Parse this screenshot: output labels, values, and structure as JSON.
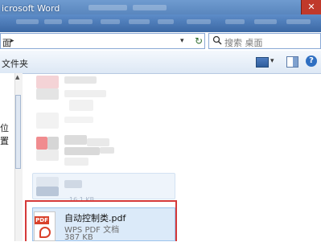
{
  "window": {
    "title": "icrosoft Word",
    "close_glyph": "✕"
  },
  "address": {
    "path_text": "面",
    "chevron": "▸",
    "dropdown": "▾",
    "refresh_glyph": "↻"
  },
  "search": {
    "placeholder": "搜索 桌面",
    "icon": "search-icon"
  },
  "commandbar": {
    "label": "文件夹",
    "view_dropdown": "▾",
    "help_glyph": "?"
  },
  "nav": {
    "label": "位置",
    "scroll_up": "▲"
  },
  "files": [
    {
      "name": "自动控制类.pdf",
      "type": "WPS PDF 文档",
      "size": "387 KB",
      "icon_tag": "PDF",
      "selected": true
    }
  ],
  "partial_row_text": "16.1 KB",
  "colors": {
    "highlight_border": "#d53a3a",
    "selection_fill": "#dbeaf9",
    "titlebar": "#3f6da8"
  }
}
